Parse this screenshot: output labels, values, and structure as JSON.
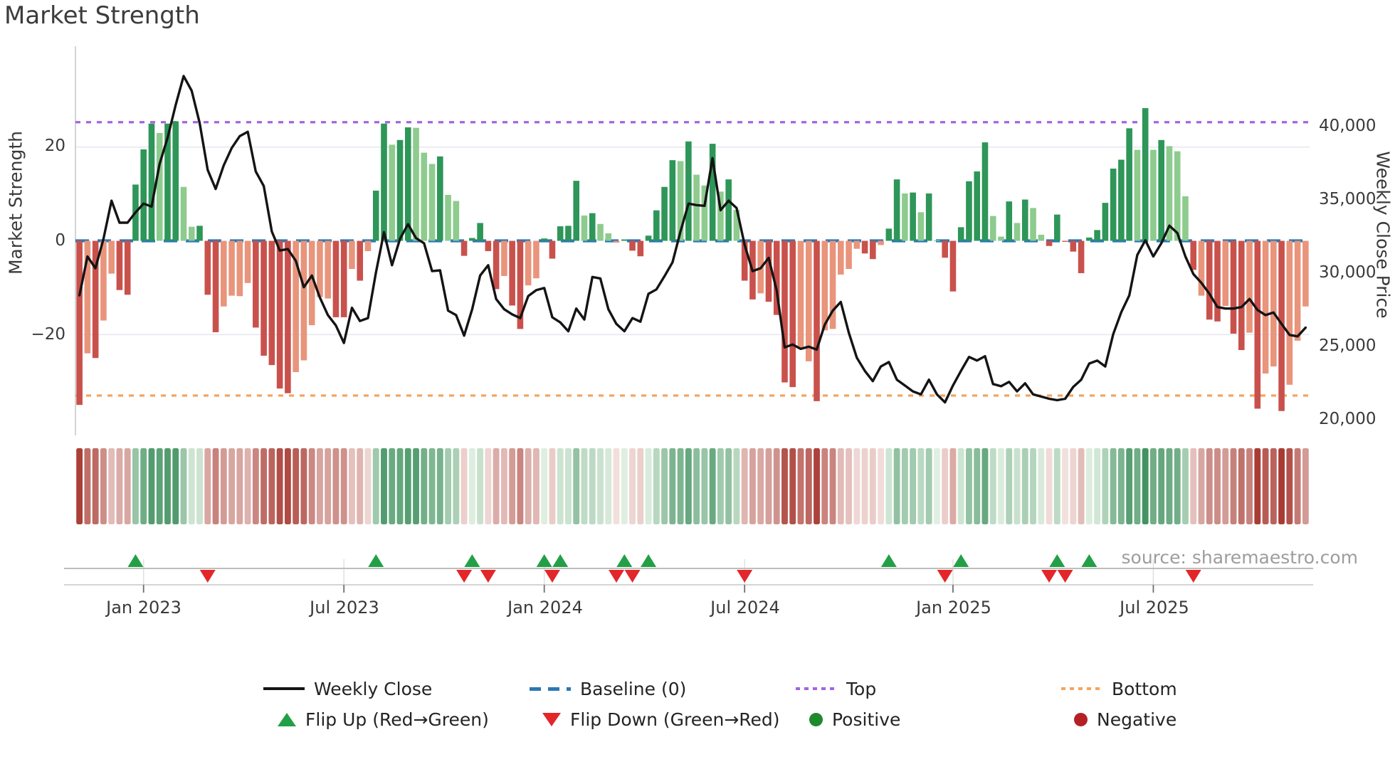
{
  "title": "Market Strength",
  "source_note": "source: sharemaestro.com",
  "axes": {
    "left_title": "Market Strength",
    "right_title": "Weekly Close Price",
    "left_tick_labels": [
      "20",
      "0",
      "−20"
    ],
    "right_tick_labels": [
      "40,000",
      "35,000",
      "30,000",
      "25,000",
      "20,000"
    ],
    "x_tick_labels": [
      "Jan 2023",
      "Jul 2023",
      "Jan 2024",
      "Jul 2024",
      "Jan 2025",
      "Jul 2025"
    ]
  },
  "legend": {
    "row1": [
      {
        "label": "Weekly Close"
      },
      {
        "label": "Baseline (0)"
      },
      {
        "label": "Top"
      },
      {
        "label": "Bottom"
      }
    ],
    "row2": [
      {
        "label": "Flip Up (Red→Green)"
      },
      {
        "label": "Flip Down (Green→Red)"
      },
      {
        "label": "Positive"
      },
      {
        "label": "Negative"
      }
    ]
  },
  "colors": {
    "bar_pos_strong": "#2e9658",
    "bar_pos_weak": "#8ecb8e",
    "bar_neg_strong": "#c9514c",
    "bar_neg_weak": "#e8957c",
    "line": "#141414",
    "baseline": "#2878b5",
    "top": "#a264e3",
    "bottom": "#f4a460",
    "flip_up": "#23a047",
    "flip_down": "#e3262a",
    "grid": "#e7e7f0",
    "spine": "#cfcfcf",
    "heat_pos_strong": "#1b7c42",
    "heat_neg_strong": "#a83c34"
  },
  "chart_data": {
    "type": "bar+line",
    "title": "Market Strength",
    "x_label": "",
    "x_tick_positions": [
      8,
      33,
      58,
      83,
      109,
      134
    ],
    "x_tick_labels": [
      "Jan 2023",
      "Jul 2023",
      "Jan 2024",
      "Jul 2024",
      "Jan 2025",
      "Jul 2025"
    ],
    "left_axis": {
      "label": "Market Strength",
      "min": -41.5,
      "max": 41.5,
      "ticks": [
        20,
        0,
        -20
      ]
    },
    "right_axis": {
      "label": "Weekly Close Price",
      "min": 18900,
      "max": 45430,
      "ticks": [
        40000,
        35000,
        30000,
        25000,
        20000
      ]
    },
    "baseline_level": 0,
    "top_level": 25.3,
    "bottom_level": -33,
    "series": [
      {
        "name": "Market Strength",
        "type": "bar"
      },
      {
        "name": "Weekly Close",
        "type": "line"
      }
    ],
    "strength": [
      -35,
      -24,
      -25,
      -17,
      -7,
      -10.5,
      -11.5,
      12,
      19.5,
      25,
      23,
      25,
      25.5,
      11.5,
      3,
      3.2,
      -11.5,
      -19.5,
      -14,
      -11.7,
      -11.8,
      -9,
      -18.5,
      -24.5,
      -26.5,
      -31.5,
      -32.5,
      -28,
      -25.5,
      -18,
      -12,
      -12.3,
      -16.3,
      -16.3,
      -6,
      -8.5,
      -2.2,
      10.7,
      25,
      20.5,
      21.5,
      24.2,
      24.1,
      18.8,
      16.4,
      18,
      9.8,
      8.5,
      -3.2,
      0.6,
      3.8,
      -2.2,
      -10.3,
      -7.5,
      -13.8,
      -18.8,
      -9.5,
      -8,
      0.5,
      -3.8,
      3.1,
      3.2,
      12.8,
      5.4,
      5.9,
      3.6,
      1.6,
      -0.4,
      0.3,
      -2.1,
      -3.3,
      1.1,
      6.5,
      11.5,
      17.2,
      17,
      21.2,
      14.1,
      11.8,
      20.7,
      10.5,
      13.1,
      6.6,
      -8.5,
      -12.5,
      -11.2,
      -13,
      -15.8,
      -30.2,
      -31.2,
      -23.1,
      -25.7,
      -34.2,
      -19.1,
      -18.8,
      -7.2,
      -6,
      -1.7,
      -2.7,
      -3.9,
      -0.9,
      2.6,
      13.1,
      10.1,
      10.3,
      6.1,
      10.1,
      0.1,
      -3.6,
      -10.8,
      2.9,
      12.7,
      14.8,
      21,
      5.3,
      0.9,
      8.4,
      3.8,
      8.8,
      7,
      1.3,
      -1.1,
      5.6,
      -0.2,
      -2.3,
      -6.9,
      0.7,
      2.3,
      8.1,
      15.4,
      17.3,
      24,
      19.4,
      28.3,
      19.4,
      21.5,
      20.2,
      19.1,
      9.5,
      -6.2,
      -11.7,
      -16.8,
      -17.2,
      -13.9,
      -19.8,
      -23.3,
      -19.6,
      -35.8,
      -28.3,
      -26.8,
      -36.3,
      -30.7,
      -21.3,
      -14
    ],
    "shade": "dldlldddddlddlldddllllddddd lllll ddldlddlddllldllddd ddlddll dddddldll lddd ddddldlldldl ddlddddlldlllllddl ddldldl dd ddddlldldll ddddd ddddddldldlll dlddlddldlldlll",
    "weekly_close": [
      28450,
      31100,
      30300,
      32300,
      34900,
      33400,
      33400,
      34100,
      34700,
      34500,
      37400,
      39200,
      41400,
      43400,
      42400,
      40200,
      37000,
      35700,
      37300,
      38500,
      39300,
      39600,
      36900,
      35900,
      32800,
      31500,
      31600,
      30800,
      29000,
      29800,
      28300,
      27100,
      26400,
      25200,
      27600,
      26700,
      26900,
      30000,
      32750,
      30500,
      32300,
      33300,
      32350,
      32000,
      30100,
      30150,
      27400,
      27100,
      25700,
      27500,
      29800,
      30500,
      28200,
      27500,
      27150,
      26900,
      28400,
      28800,
      28950,
      26950,
      26600,
      26000,
      27550,
      26800,
      29700,
      29600,
      27500,
      26500,
      26000,
      26900,
      26650,
      28550,
      28850,
      29750,
      30700,
      32800,
      34700,
      34600,
      34550,
      37800,
      34250,
      34900,
      34400,
      31900,
      30100,
      30300,
      31000,
      28800,
      24900,
      25100,
      24800,
      24950,
      24750,
      26450,
      27400,
      28000,
      25900,
      24200,
      23300,
      22600,
      23600,
      23900,
      22700,
      22300,
      21900,
      21700,
      22700,
      21700,
      21150,
      22300,
      23300,
      24250,
      24000,
      24300,
      22400,
      22250,
      22550,
      21900,
      22450,
      21700,
      21550,
      21400,
      21300,
      21400,
      22200,
      22700,
      23800,
      24000,
      23600,
      25800,
      27300,
      28450,
      31200,
      32200,
      31100,
      32000,
      33200,
      32700,
      31100,
      29900,
      29300,
      28550,
      27650,
      27550,
      27550,
      27650,
      28200,
      27450,
      27100,
      27280,
      26500,
      25750,
      25650,
      26250
    ],
    "flip_rule": "up marker at first positive bar after negative; down marker at first negative bar after positive",
    "heatmap": "one cell per week, diverging red→green gradient proportional to strength value",
    "grid_on": true,
    "legend_position": "bottom"
  }
}
